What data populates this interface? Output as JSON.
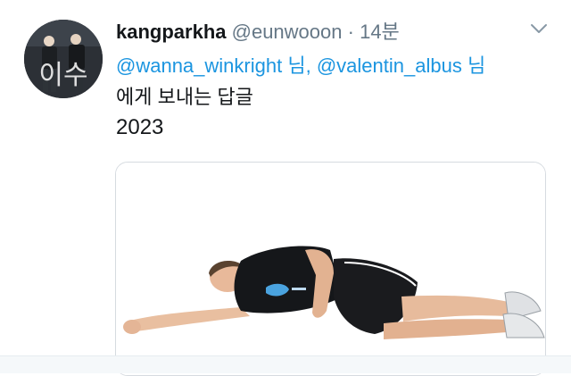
{
  "tweet": {
    "username": "kangparkha",
    "handle": "@eunwooon",
    "separator": "·",
    "time": "14분",
    "reply_to": {
      "mention1": "@wanna_winkright",
      "suffix1": "님,",
      "mention2": "@valentin_albus",
      "suffix2": "님",
      "line2": "에게 보내는 답글"
    },
    "text": "2023"
  },
  "media": {
    "description": "photo"
  },
  "avatar": {
    "lettering": "이수"
  },
  "icons": {
    "menu": "chevron-down-icon"
  },
  "colors": {
    "link": "#1b95e0",
    "secondary_text": "#657786",
    "primary_text": "#14171a"
  }
}
